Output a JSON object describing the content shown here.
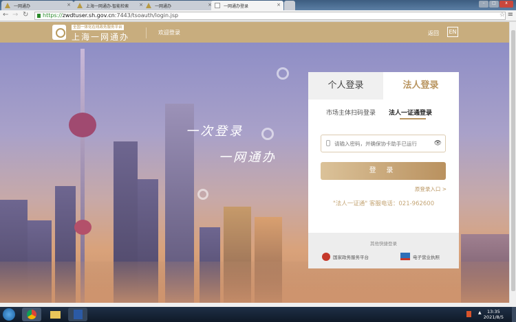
{
  "browser": {
    "tabs": [
      {
        "label": "一网通办",
        "active": false
      },
      {
        "label": "上海一网通办-智能检索",
        "active": false
      },
      {
        "label": "一网通办",
        "active": false
      },
      {
        "label": "一网通办登录",
        "active": true
      }
    ],
    "url": {
      "scheme": "https://",
      "host": "zwdtuser.sh.gov.cn",
      "rest": ":7443/tsoauth/login.jsp"
    }
  },
  "header": {
    "slogan": "全国一体化在线政务服务平台",
    "brand": "上海一网通办",
    "welcome": "欢迎登录",
    "back": "返回",
    "lang": "EN"
  },
  "hero": {
    "line1": "一次登录",
    "line2": "一网通办"
  },
  "login_panel": {
    "tabs": [
      "个人登录",
      "法人登录"
    ],
    "active_tab": "法人登录",
    "subtabs": [
      "市场主体扫码登录",
      "法人一证通登录"
    ],
    "active_subtab": "法人一证通登录",
    "password_placeholder": "请输入密码，并确保协卡助手已运行",
    "login_button": "登 录",
    "old_entry": "原登录入口 >",
    "hotline": "\"法人一证通\" 客服电话：021-962600",
    "quick_login": {
      "title": "其他快捷登录",
      "items": [
        "国家政务服务平台",
        "电子营业执照"
      ]
    }
  },
  "taskbar": {
    "time": "13:35",
    "date": "2021/8/5"
  },
  "colors": {
    "gold": "#c8ad7e",
    "accent": "#b99560"
  }
}
